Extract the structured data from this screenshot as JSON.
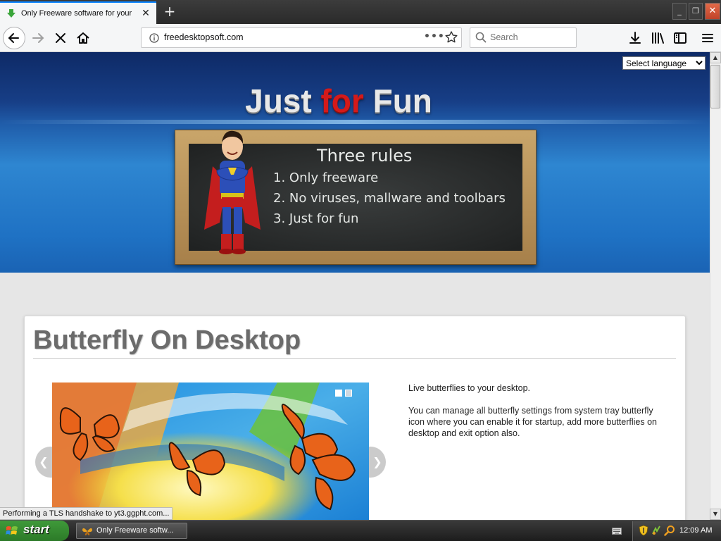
{
  "browser": {
    "tab_title": "Only Freeware software for your PC",
    "url": "freedesktopsoft.com",
    "search_placeholder": "Search",
    "new_tab_label": "+",
    "tab_close_label": "✕",
    "win_min_label": "_",
    "win_max_label": "❐",
    "win_close_label": "✕",
    "url_more_label": "•••"
  },
  "page": {
    "language_select": {
      "selected": "Select language"
    },
    "hero": {
      "title_part1": "Just ",
      "title_part2": "for",
      "title_part3": " Fun",
      "board_title": "Three rules",
      "rules": [
        "1. Only freeware",
        "2. No viruses, mallware and toolbars",
        "3. Just for fun"
      ]
    },
    "post": {
      "title": "Butterfly On Desktop",
      "description_1": "Live butterflies to your desktop.",
      "description_2": "You can manage all butterfly settings from system tray butterfly icon where you can enable it for startup, add more butterflies on desktop and exit option also.",
      "slider_prev": "❮",
      "slider_next": "❯"
    },
    "status_text": "Performing a TLS handshake to yt3.ggpht.com..."
  },
  "scrollbar": {
    "up": "▲",
    "down": "▼"
  },
  "taskbar": {
    "start_label": "start",
    "task_label": "Only Freeware softw...",
    "clock": "12:09 AM"
  },
  "colors": {
    "accent_tab": "#0a84ff",
    "hero_dark": "#0e2a66",
    "hero_light": "#2e86d1",
    "title_red": "#d41a1a",
    "start_green": "#3f9a3a"
  }
}
